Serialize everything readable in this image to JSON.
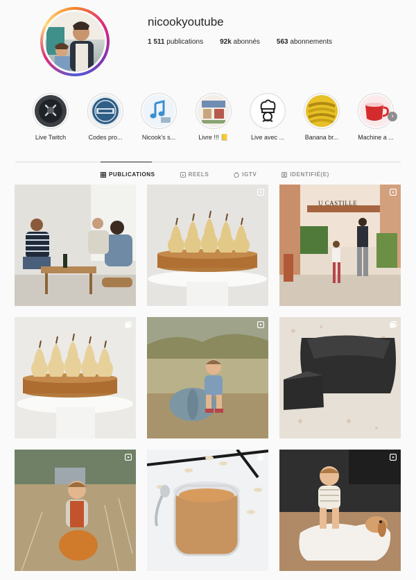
{
  "profile": {
    "username": "nicookyoutube",
    "publications_count": "1 511",
    "publications_label": "publications",
    "followers_count": "92k",
    "followers_label": "abonnés",
    "following_count": "563",
    "following_label": "abonnements"
  },
  "highlights": [
    {
      "label": "Live Twitch",
      "icon": "twitch-icon"
    },
    {
      "label": "Codes pro...",
      "icon": "nicook-logo"
    },
    {
      "label": "Nicook's s...",
      "icon": "music-note-icon"
    },
    {
      "label": "Livre !!! 📒",
      "icon": "book-icon"
    },
    {
      "label": "Live avec ...",
      "icon": "chef-hat-icon"
    },
    {
      "label": "Banana br...",
      "icon": "banana-icon"
    },
    {
      "label": "Machine a ...",
      "icon": "coffee-cup-icon"
    }
  ],
  "tabs": [
    {
      "label": "PUBLICATIONS",
      "icon": "grid-icon",
      "active": true
    },
    {
      "label": "REELS",
      "icon": "reels-icon",
      "active": false
    },
    {
      "label": "IGTV",
      "icon": "igtv-icon",
      "active": false
    },
    {
      "label": "IDENTIFIÉ(E)",
      "icon": "tagged-icon",
      "active": false
    }
  ],
  "posts": [
    {
      "subject": "friends-toasting",
      "overlay_icon": null
    },
    {
      "subject": "pear-tart",
      "overlay_icon": "reel-icon"
    },
    {
      "subject": "u-castille-street",
      "overlay_icon": "reel-icon",
      "sign_text": "U CASTILLE"
    },
    {
      "subject": "pear-tart-cakestand",
      "overlay_icon": "multi-icon"
    },
    {
      "subject": "toddler-pumpkin",
      "overlay_icon": "reel-icon"
    },
    {
      "subject": "black-cake",
      "overlay_icon": "multi-icon"
    },
    {
      "subject": "toddler-field",
      "overlay_icon": "reel-icon"
    },
    {
      "subject": "peanut-butter-jar",
      "overlay_icon": "multi-icon"
    },
    {
      "subject": "toddler-dog",
      "overlay_icon": "reel-icon"
    }
  ],
  "colors": {
    "accent_text": "#262626",
    "muted_text": "#8e8e8e",
    "border": "#dbdbdb"
  }
}
